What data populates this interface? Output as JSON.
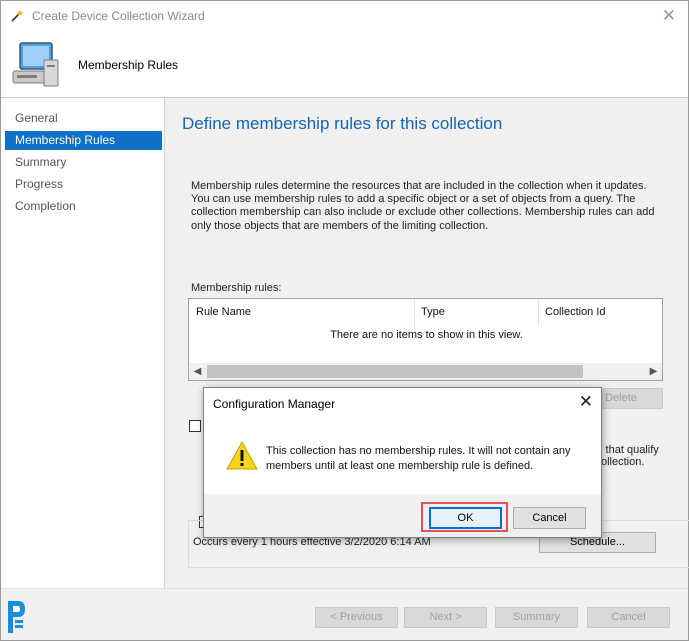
{
  "window": {
    "title": "Create Device Collection Wizard",
    "close_glyph": "✕"
  },
  "header": {
    "title": "Membership Rules",
    "icon": "computer-icon"
  },
  "nav": {
    "items": [
      {
        "label": "General",
        "active": false
      },
      {
        "label": "Membership Rules",
        "active": true
      },
      {
        "label": "Summary",
        "active": false
      },
      {
        "label": "Progress",
        "active": false
      },
      {
        "label": "Completion",
        "active": false
      }
    ]
  },
  "page": {
    "heading": "Define membership rules for this collection",
    "description": "Membership rules determine the resources that are included in the collection when it updates. You can use membership rules to add a specific object or a set of objects from a query. The collection membership can also include or exclude other collections. Membership rules can add only those objects that are members of the limiting collection.",
    "rules_label": "Membership rules:",
    "columns": [
      "Rule Name",
      "Type",
      "Collection Id"
    ],
    "empty_message": "There are no items to show in this view.",
    "delete_label": "Delete",
    "partial_text_1": "s that qualify",
    "partial_text_2": "ollection.",
    "occurs_text": "Occurs every 1 hours effective 3/2/2020 6:14 AM",
    "schedule_label": "Schedule..."
  },
  "footer": {
    "previous_label": "< Previous",
    "next_label": "Next >",
    "summary_label": "Summary",
    "cancel_label": "Cancel"
  },
  "dialog": {
    "title": "Configuration Manager",
    "close_glyph": "✕",
    "message": "This collection has no membership rules. It will not contain any members until at least one membership rule is defined.",
    "ok_label": "OK",
    "cancel_label": "Cancel",
    "icon": "warning-icon"
  },
  "colors": {
    "accent": "#0f70c7",
    "heading": "#1464b4",
    "highlight": "#e05454"
  }
}
